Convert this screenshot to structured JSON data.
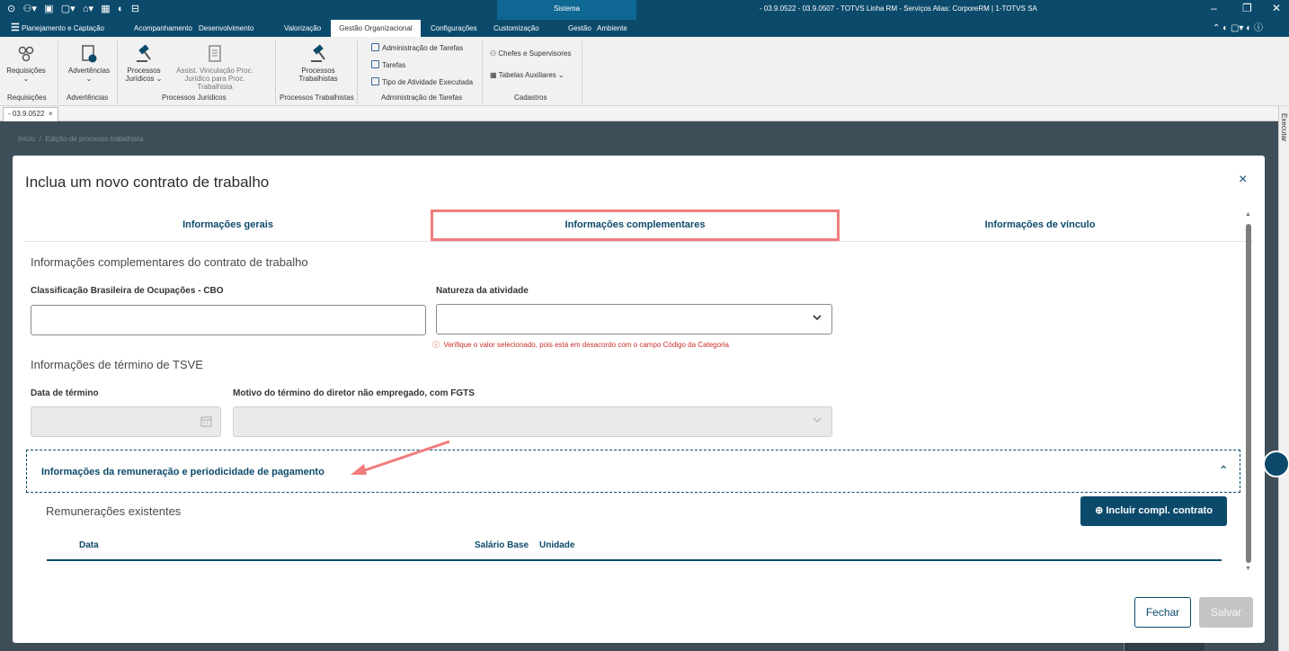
{
  "titlebar": {
    "system_label": "Sistema",
    "window_title": "- 03.9.0522 - 03.9.0507 - TOTVS Linha RM - Serviços  Alias: CorporeRM | 1-TOTVS SA",
    "minimize": "–",
    "restore": "❐",
    "close": "✕"
  },
  "menu": {
    "items": [
      "Planejamento e Captação",
      "Acompanhamento",
      "Desenvolvimento",
      "Valorização",
      "Gestão Organizacional",
      "Configurações",
      "Customização",
      "Gestão",
      "Ambiente"
    ],
    "active": "Gestão Organizacional"
  },
  "ribbon": {
    "requisicoes": "Requisições",
    "advertencias": "Advertências",
    "processos_juridicos": "Processos Jurídicos",
    "assist_vinculacao": "Assist. Vinculação Proc. Jurídico para Proc. Trabalhista",
    "processos_trabalhistas": "Processos Trabalhistas",
    "adm_tarefas": "Administração de Tarefas",
    "tarefas": "Tarefas",
    "tipo_atividade": "Tipo de Atividade Executada",
    "chefes": "Chefes e Supervisores",
    "tabelas": "Tabelas Auxiliares",
    "groups": {
      "requisicoes": "Requisições",
      "advertencias": "Advertências",
      "processos_juridicos": "Processos Jurídicos",
      "processos_trabalhistas": "Processos Trabalhistas",
      "adm_tarefas": "Administração de Tarefas",
      "cadastros": "Cadastros"
    }
  },
  "doctab": {
    "label": "- 03.9.0522",
    "close": "×"
  },
  "breadcrumb": {
    "home": "Início",
    "current": "Edição de processo trabalhista"
  },
  "side_label": "Executar",
  "modal": {
    "title": "Inclua um novo contrato de trabalho",
    "close": "×",
    "tabs": [
      "Informações gerais",
      "Informações complementares",
      "Informações de vínculo"
    ],
    "section1": "Informações complementares do contrato de trabalho",
    "cbo_label": "Classificação Brasileira de Ocupações - CBO",
    "cbo_value": "",
    "natureza_label": "Natureza da atividade",
    "natureza_value": "",
    "natureza_error": "Verifique o valor selecionado, pois está em desacordo com o campo Código da Categoria",
    "section2": "Informações de término de TSVE",
    "data_termino_label": "Data de término",
    "motivo_label": "Motivo do término do diretor não empregado, com FGTS",
    "accordion_title": "Informações da remuneração e periodicidade de pagamento",
    "remuneracoes_title": "Remunerações existentes",
    "add_button": "Incluir compl. contrato",
    "table_headers": [
      "Data",
      "Salário Base",
      "Unidade"
    ],
    "btn_fechar": "Fechar",
    "btn_salvar": "Salvar"
  }
}
